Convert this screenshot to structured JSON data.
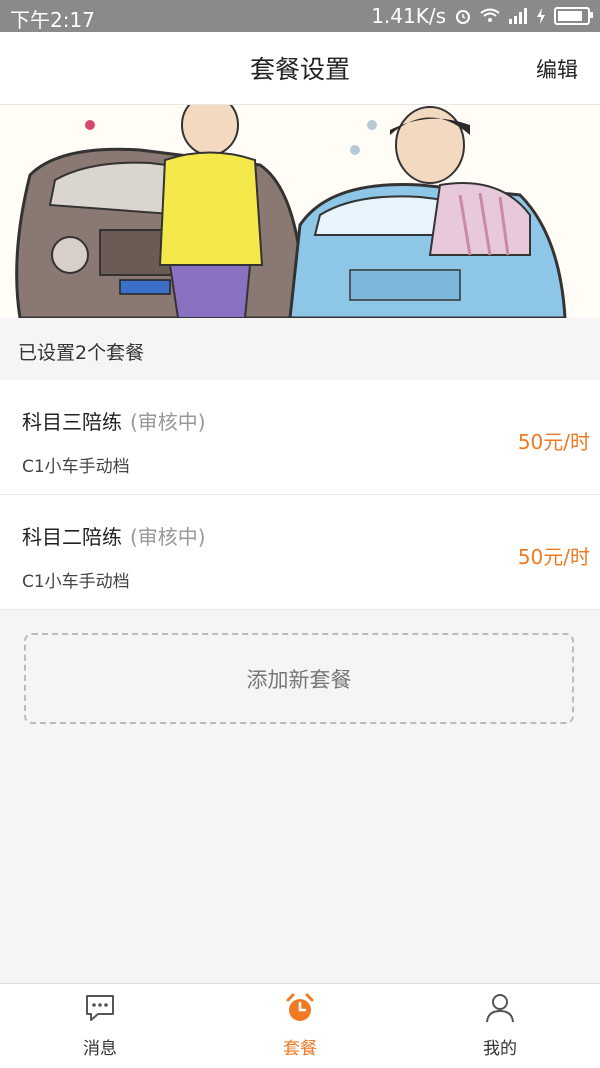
{
  "status_bar": {
    "time": "下午2:17",
    "network_speed": "1.41K/s"
  },
  "header": {
    "title": "套餐设置",
    "edit_label": "编辑"
  },
  "summary": {
    "count_text": "已设置2个套餐"
  },
  "packages": [
    {
      "name": "科目三陪练",
      "status": "(审核中)",
      "vehicle": "C1小车手动档",
      "price": "50元/时"
    },
    {
      "name": "科目二陪练",
      "status": "(审核中)",
      "vehicle": "C1小车手动档",
      "price": "50元/时"
    }
  ],
  "add_button": {
    "label": "添加新套餐"
  },
  "tabbar": {
    "items": [
      {
        "label": "消息",
        "icon": "chat-icon"
      },
      {
        "label": "套餐",
        "icon": "alarm-clock-icon",
        "active": true
      },
      {
        "label": "我的",
        "icon": "user-icon"
      }
    ]
  },
  "colors": {
    "accent": "#f07a24",
    "background": "#f5f5f5"
  }
}
